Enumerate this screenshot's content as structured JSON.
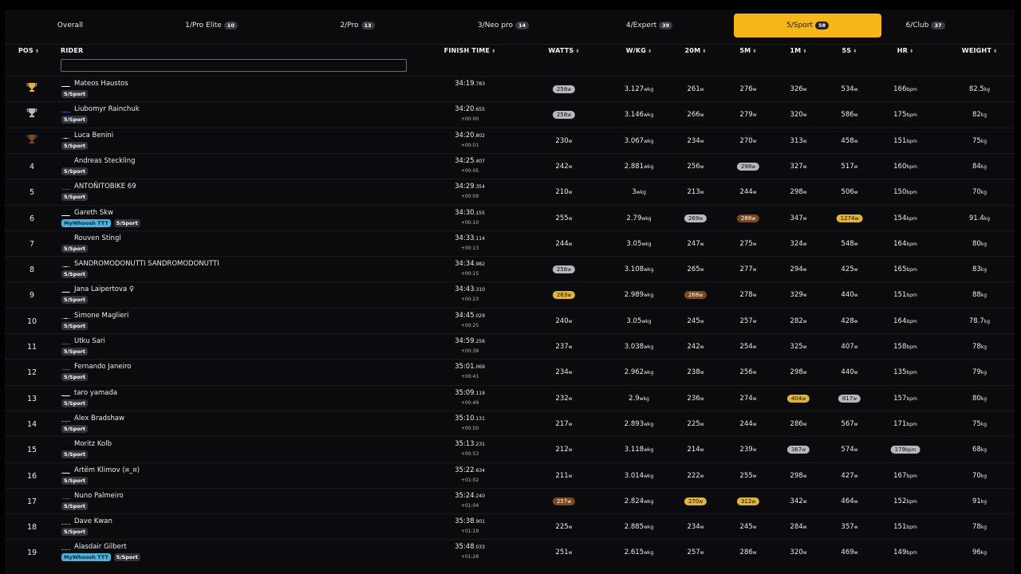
{
  "tabs": [
    {
      "label": "Overall",
      "count": ""
    },
    {
      "label": "1/Pro Elite",
      "count": "10"
    },
    {
      "label": "2/Pro",
      "count": "13"
    },
    {
      "label": "3/Neo pro",
      "count": "14"
    },
    {
      "label": "4/Expert",
      "count": "39"
    },
    {
      "label": "5/Sport",
      "count": "58",
      "active": true
    },
    {
      "label": "6/Club",
      "count": "37"
    }
  ],
  "colors": {
    "accent": "#f7b718",
    "silver": "#b9b9bd",
    "gold": "#e0b43a",
    "bronze": "#7a4a1c",
    "ttt": "#4fb0d8"
  },
  "columns": [
    "POS",
    "RIDER",
    "FINISH TIME",
    "WATTS",
    "W/KG",
    "20M",
    "5M",
    "1M",
    "5S",
    "HR",
    "WEIGHT"
  ],
  "sort_icon": "⬍",
  "filter": {
    "value": "",
    "placeholder": ""
  },
  "units": {
    "w": "w",
    "wkg": "wkg",
    "bpm": "bpm",
    "kg": "kg"
  },
  "riders": [
    {
      "pos": "",
      "trophy": "gold",
      "name": "Mateos Haustos",
      "flag": "pl",
      "tags": [
        "5/Sport"
      ],
      "time": "34:19",
      "ms": ".783",
      "gap": "",
      "watts": "258",
      "wkg": "3.127",
      "m20": "261",
      "m5": "276",
      "m1": "326",
      "s5": "534",
      "hr": "166",
      "weight": "82.5",
      "hl": {
        "watts": "silver"
      }
    },
    {
      "pos": "",
      "trophy": "silver",
      "name": "Liubomyr Rainchuk",
      "flag": "ua",
      "tags": [
        "5/Sport"
      ],
      "time": "34:20",
      "ms": ".655",
      "gap": "+00:00",
      "watts": "258",
      "wkg": "3.146",
      "m20": "266",
      "m5": "279",
      "m1": "320",
      "s5": "586",
      "hr": "175",
      "weight": "82",
      "hl": {
        "watts": "silver"
      }
    },
    {
      "pos": "",
      "trophy": "bronze",
      "name": "Luca Benini",
      "flag": "it",
      "tags": [
        "5/Sport"
      ],
      "time": "34:20",
      "ms": ".802",
      "gap": "+00:01",
      "watts": "230",
      "wkg": "3.067",
      "m20": "234",
      "m5": "270",
      "m1": "313",
      "s5": "458",
      "hr": "151",
      "weight": "75",
      "hl": {}
    },
    {
      "pos": "4",
      "name": "Andreas Steckling",
      "flag": "de",
      "tags": [
        "5/Sport"
      ],
      "time": "34:25",
      "ms": ".407",
      "gap": "+00:05",
      "watts": "242",
      "wkg": "2.881",
      "m20": "256",
      "m5": "298",
      "m1": "327",
      "s5": "517",
      "hr": "160",
      "weight": "84",
      "hl": {
        "m5": "silver"
      }
    },
    {
      "pos": "5",
      "name": "ANTOÑITOBIKE 69",
      "flag": "es",
      "tags": [
        "5/Sport"
      ],
      "time": "34:29",
      "ms": ".354",
      "gap": "+00:09",
      "watts": "210",
      "wkg": "3",
      "m20": "213",
      "m5": "244",
      "m1": "298",
      "s5": "506",
      "hr": "150",
      "weight": "70",
      "hl": {}
    },
    {
      "pos": "6",
      "name": "Gareth Skw",
      "flag": "wl",
      "tags": [
        "MyWhoosh TTT",
        "5/Sport"
      ],
      "time": "34:30",
      "ms": ".155",
      "gap": "+00:10",
      "watts": "255",
      "wkg": "2.79",
      "m20": "269",
      "m5": "288",
      "m1": "347",
      "s5": "1274",
      "hr": "154",
      "weight": "91.4",
      "hl": {
        "m20": "silver",
        "m5": "bronze",
        "s5": "gold"
      }
    },
    {
      "pos": "7",
      "name": "Rouven Stingl",
      "flag": "de",
      "tags": [
        "5/Sport"
      ],
      "time": "34:33",
      "ms": ".114",
      "gap": "+00:13",
      "watts": "244",
      "wkg": "3.05",
      "m20": "247",
      "m5": "275",
      "m1": "324",
      "s5": "548",
      "hr": "164",
      "weight": "80",
      "hl": {}
    },
    {
      "pos": "8",
      "name": "SANDROMODONUTTI SANDROMODONUTTI",
      "flag": "it",
      "tags": [
        "5/Sport"
      ],
      "time": "34:34",
      "ms": ".982",
      "gap": "+00:15",
      "watts": "258",
      "wkg": "3.108",
      "m20": "265",
      "m5": "277",
      "m1": "294",
      "s5": "425",
      "hr": "165",
      "weight": "83",
      "hl": {
        "watts": "silver"
      }
    },
    {
      "pos": "9",
      "name": "Jana Laipertova",
      "flag": "cz",
      "tags": [
        "5/Sport"
      ],
      "female": "♀",
      "time": "34:43",
      "ms": ".310",
      "gap": "+00:23",
      "watts": "263",
      "wkg": "2.989",
      "m20": "268",
      "m5": "278",
      "m1": "329",
      "s5": "440",
      "hr": "151",
      "weight": "88",
      "hl": {
        "watts": "gold",
        "m20": "bronze"
      }
    },
    {
      "pos": "10",
      "name": "Simone Maglieri",
      "flag": "it",
      "tags": [
        "5/Sport"
      ],
      "time": "34:45",
      "ms": ".029",
      "gap": "+00:25",
      "watts": "240",
      "wkg": "3.05",
      "m20": "245",
      "m5": "257",
      "m1": "282",
      "s5": "428",
      "hr": "164",
      "weight": "78.7",
      "hl": {}
    },
    {
      "pos": "11",
      "name": "Utku Sari",
      "flag": "tr",
      "tags": [
        "5/Sport"
      ],
      "time": "34:59",
      "ms": ".256",
      "gap": "+00:39",
      "watts": "237",
      "wkg": "3.038",
      "m20": "242",
      "m5": "254",
      "m1": "325",
      "s5": "407",
      "hr": "158",
      "weight": "78",
      "hl": {}
    },
    {
      "pos": "12",
      "name": "Fernando Janeiro",
      "flag": "pt",
      "tags": [
        "5/Sport"
      ],
      "time": "35:01",
      "ms": ".069",
      "gap": "+00:41",
      "watts": "234",
      "wkg": "2.962",
      "m20": "238",
      "m5": "256",
      "m1": "298",
      "s5": "440",
      "hr": "135",
      "weight": "79",
      "hl": {}
    },
    {
      "pos": "13",
      "name": "taro yamada",
      "flag": "jp",
      "tags": [
        "5/Sport"
      ],
      "time": "35:09",
      "ms": ".119",
      "gap": "+00:49",
      "watts": "232",
      "wkg": "2.9",
      "m20": "236",
      "m5": "274",
      "m1": "404",
      "s5": "817",
      "hr": "157",
      "weight": "80",
      "hl": {
        "m1": "gold",
        "s5": "silver"
      }
    },
    {
      "pos": "14",
      "name": "Alex Bradshaw",
      "flag": "gb",
      "tags": [
        "5/Sport"
      ],
      "time": "35:10",
      "ms": ".131",
      "gap": "+00:50",
      "watts": "217",
      "wkg": "2.893",
      "m20": "225",
      "m5": "244",
      "m1": "286",
      "s5": "567",
      "hr": "171",
      "weight": "75",
      "hl": {}
    },
    {
      "pos": "15",
      "name": "Moritz Kolb",
      "flag": "de",
      "tags": [
        "5/Sport"
      ],
      "time": "35:13",
      "ms": ".231",
      "gap": "+00:53",
      "watts": "212",
      "wkg": "3.118",
      "m20": "214",
      "m5": "239",
      "m1": "367",
      "s5": "574",
      "hr": "179",
      "weight": "68",
      "hl": {
        "m1": "silver",
        "hr": "silver"
      }
    },
    {
      "pos": "16",
      "name": "Artëm Klimov (¤_¤)",
      "flag": "ru",
      "tags": [
        "5/Sport"
      ],
      "time": "35:22",
      "ms": ".634",
      "gap": "+01:02",
      "watts": "211",
      "wkg": "3.014",
      "m20": "222",
      "m5": "255",
      "m1": "298",
      "s5": "427",
      "hr": "167",
      "weight": "70",
      "hl": {}
    },
    {
      "pos": "17",
      "name": "Nuno Palmeiro",
      "flag": "pt",
      "tags": [
        "5/Sport"
      ],
      "time": "35:24",
      "ms": ".240",
      "gap": "+01:04",
      "watts": "257",
      "wkg": "2.824",
      "m20": "270",
      "m5": "312",
      "m1": "342",
      "s5": "464",
      "hr": "152",
      "weight": "91",
      "hl": {
        "watts": "bronze",
        "m20": "gold",
        "m5": "gold"
      }
    },
    {
      "pos": "18",
      "name": "Dave Kwan",
      "flag": "gb",
      "tags": [
        "5/Sport"
      ],
      "time": "35:38",
      "ms": ".901",
      "gap": "+01:19",
      "watts": "225",
      "wkg": "2.885",
      "m20": "234",
      "m5": "245",
      "m1": "284",
      "s5": "357",
      "hr": "151",
      "weight": "78",
      "hl": {}
    },
    {
      "pos": "19",
      "name": "Alasdair Gilbert",
      "flag": "gb",
      "tags": [
        "MyWhoosh TTT",
        "5/Sport"
      ],
      "time": "35:48",
      "ms": ".033",
      "gap": "+01:28",
      "watts": "251",
      "wkg": "2.615",
      "m20": "257",
      "m5": "286",
      "m1": "320",
      "s5": "469",
      "hr": "149",
      "weight": "96",
      "hl": {}
    }
  ]
}
